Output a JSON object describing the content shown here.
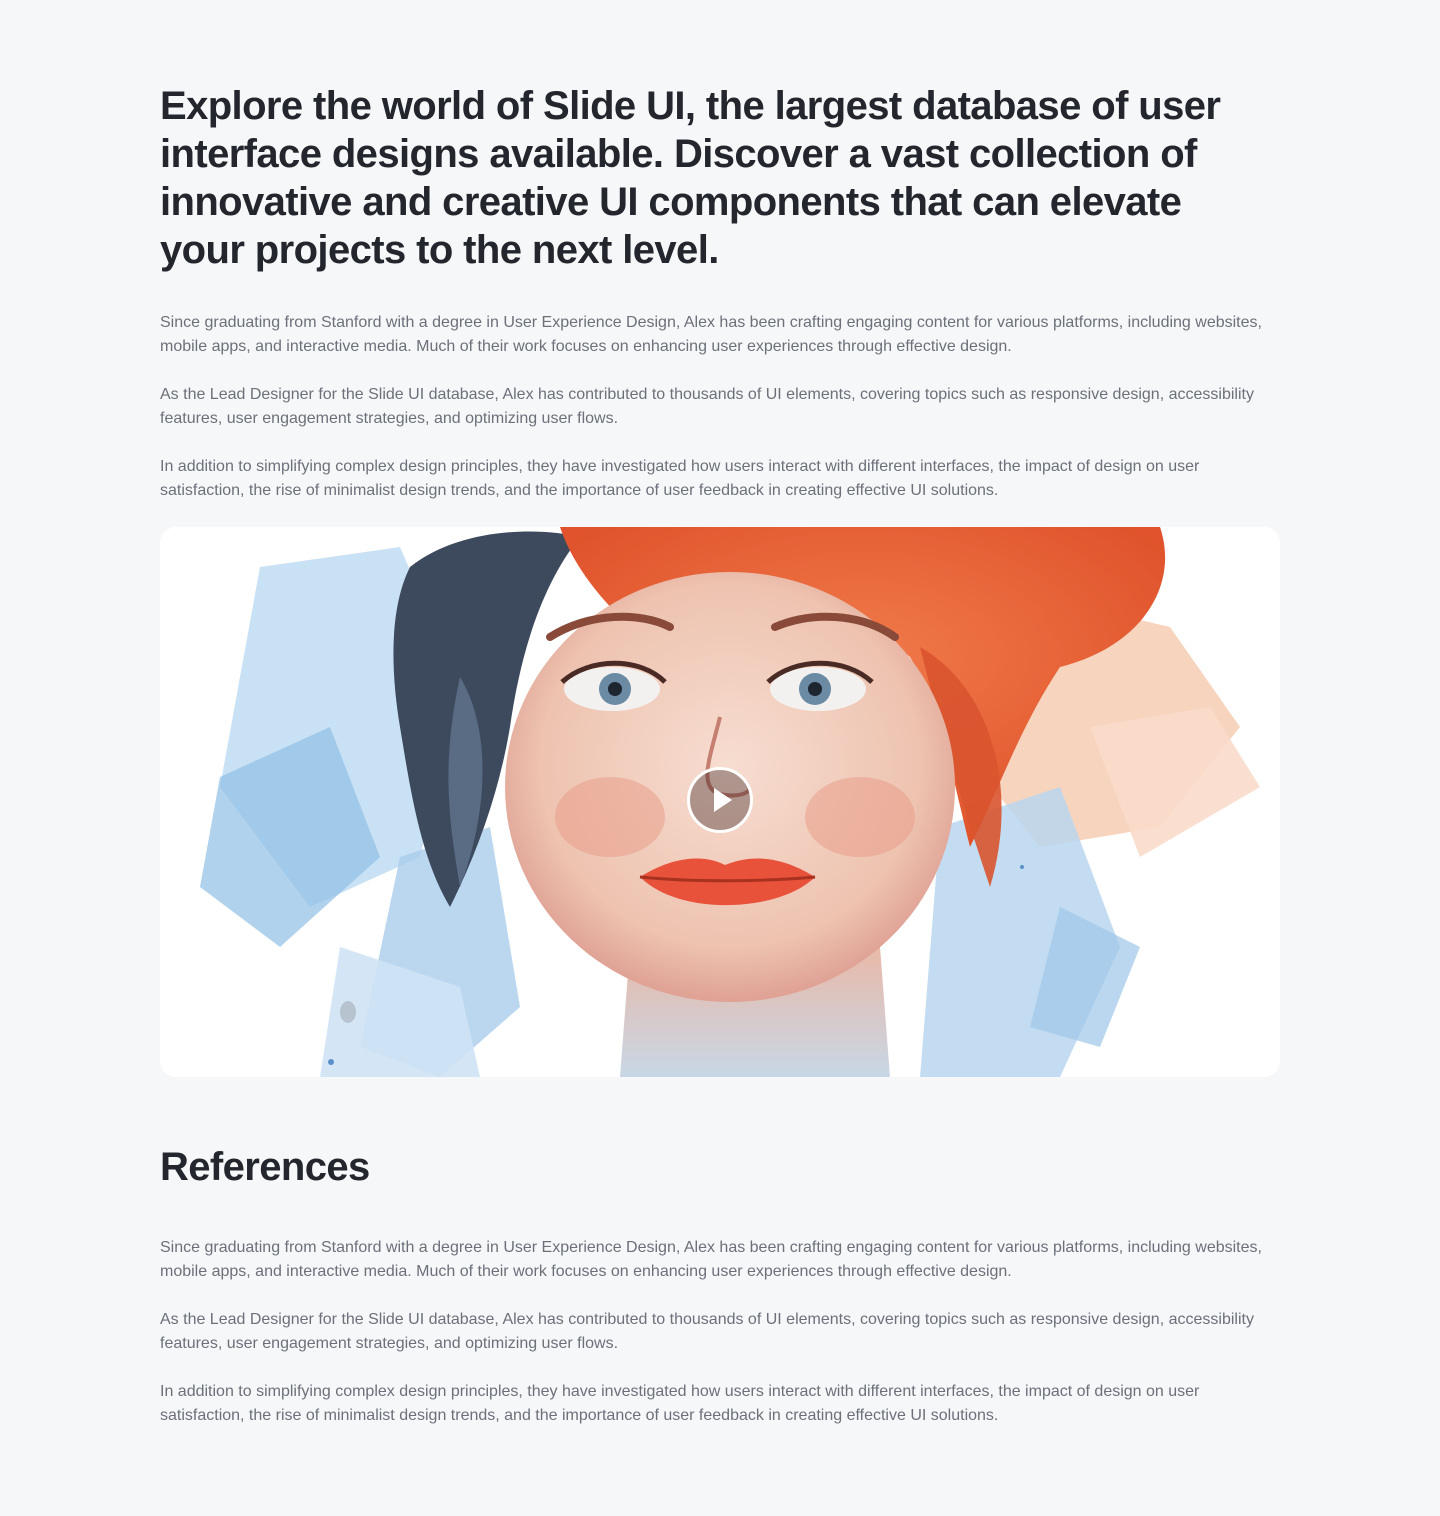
{
  "hero": {
    "heading": "Explore the world of Slide UI, the largest database of user interface designs available. Discover a vast collection of innovative and creative UI components that can elevate your projects to the next level."
  },
  "intro": {
    "paragraphs": [
      "Since graduating from Stanford with a degree in User Experience Design, Alex has been crafting engaging content for various platforms, including websites, mobile apps, and interactive media. Much of their work focuses on enhancing user experiences through effective design.",
      "As the Lead Designer for the Slide UI database, Alex has contributed to thousands of UI elements, covering topics such as responsive design, accessibility features, user engagement strategies, and optimizing user flows.",
      "In addition to simplifying complex design principles, they have investigated how users interact with different interfaces, the impact of design on user satisfaction, the rise of minimalist design trends, and the importance of user feedback in creating effective UI solutions."
    ]
  },
  "media": {
    "play_icon": "play-icon",
    "accent_orange": "#e8623a",
    "accent_blue": "#8fbfe6"
  },
  "references": {
    "title": "References",
    "paragraphs": [
      "Since graduating from Stanford with a degree in User Experience Design, Alex has been crafting engaging content for various platforms, including websites, mobile apps, and interactive media. Much of their work focuses on enhancing user experiences through effective design.",
      "As the Lead Designer for the Slide UI database, Alex has contributed to thousands of UI elements, covering topics such as responsive design, accessibility features, user engagement strategies, and optimizing user flows.",
      "In addition to simplifying complex design principles, they have investigated how users interact with different interfaces, the impact of design on user satisfaction, the rise of minimalist design trends, and the importance of user feedback in creating effective UI solutions."
    ]
  }
}
